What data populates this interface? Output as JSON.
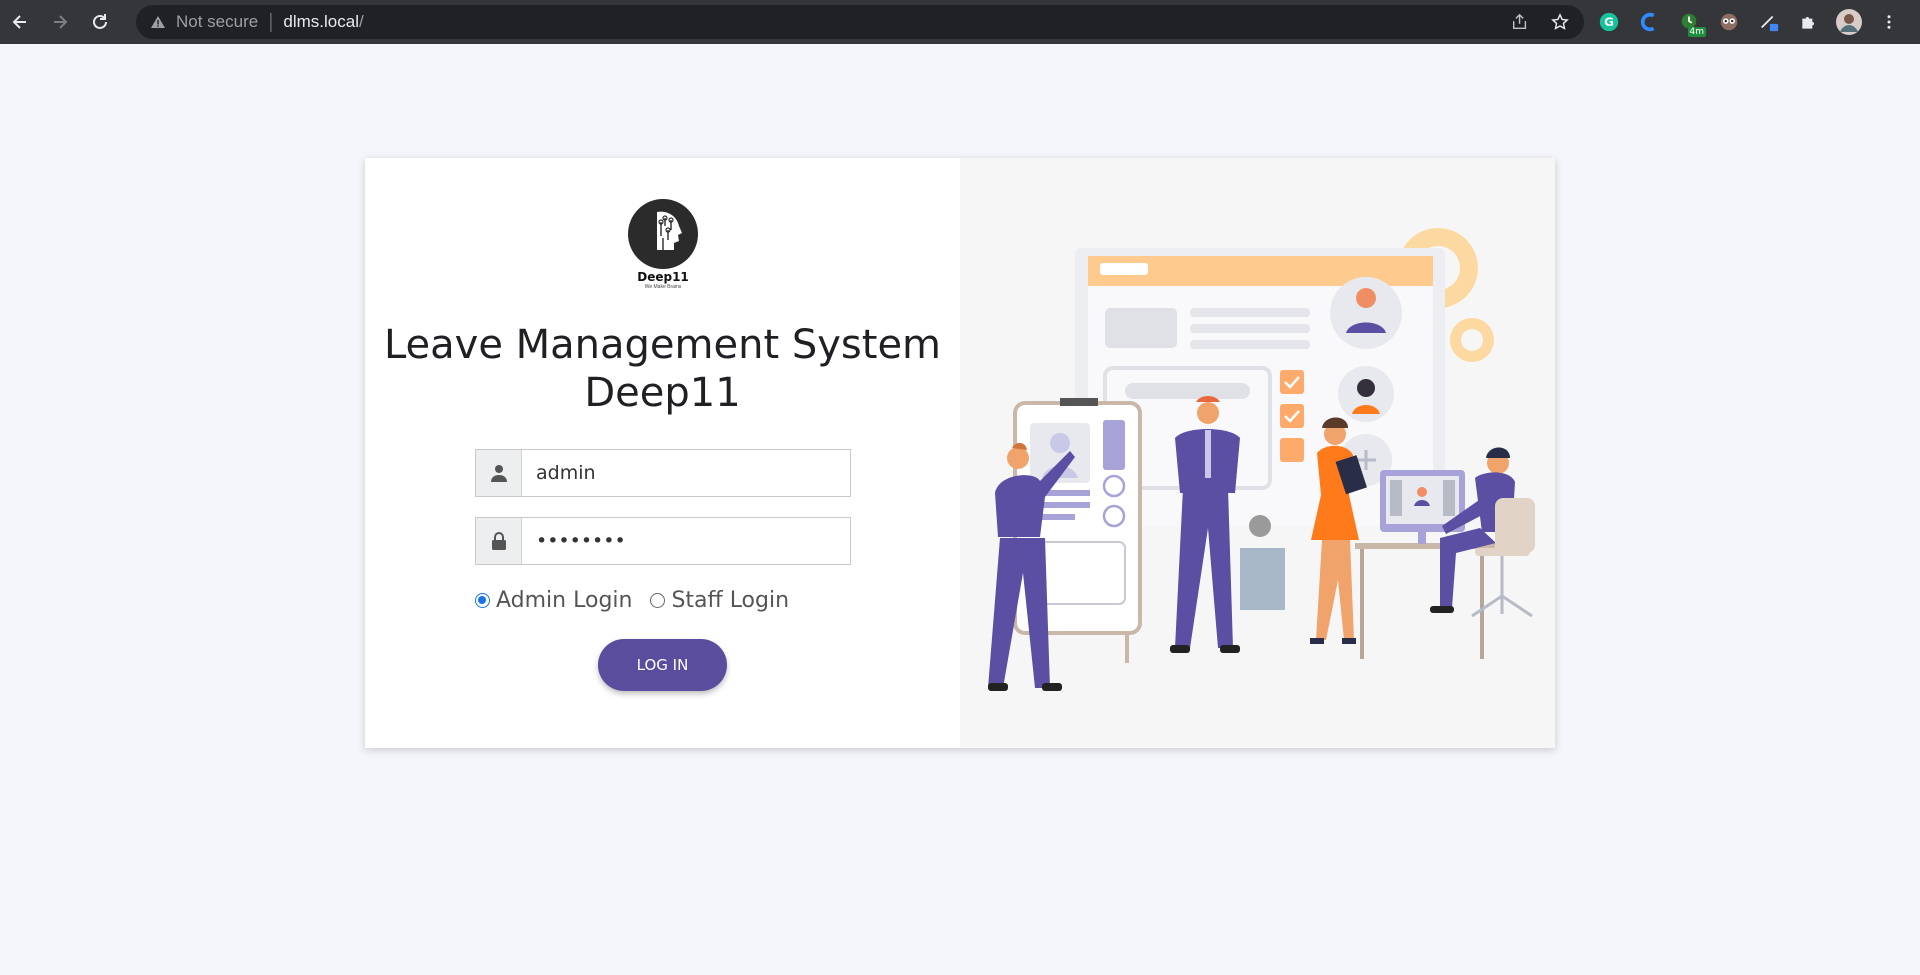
{
  "browser": {
    "not_secure_label": "Not secure",
    "url_host": "dlms.local",
    "url_path": "/",
    "extensions": [
      {
        "icon": "grammarly-icon"
      },
      {
        "icon": "c-extension-icon"
      },
      {
        "icon": "clock-extension-icon",
        "badge": "4m"
      },
      {
        "icon": "owl-extension-icon"
      },
      {
        "icon": "pen-extension-icon"
      },
      {
        "icon": "puzzle-icon"
      },
      {
        "icon": "profile-avatar"
      },
      {
        "icon": "kebab-menu-icon"
      }
    ]
  },
  "login": {
    "logo_name": "Deep11",
    "logo_tagline": "We Make Brains",
    "title_line1": "Leave Management System",
    "title_line2": "Deep11",
    "username_value": "admin",
    "password_value": "••••••••",
    "roles": [
      {
        "label": "Admin Login",
        "selected": true
      },
      {
        "label": "Staff Login",
        "selected": false
      }
    ],
    "submit_label": "LOG IN"
  },
  "colors": {
    "accent": "#5b4d9e",
    "page_bg": "#f5f6fc",
    "illustration_orange": "#ff7a1a",
    "illustration_purple": "#5a4fa3"
  }
}
